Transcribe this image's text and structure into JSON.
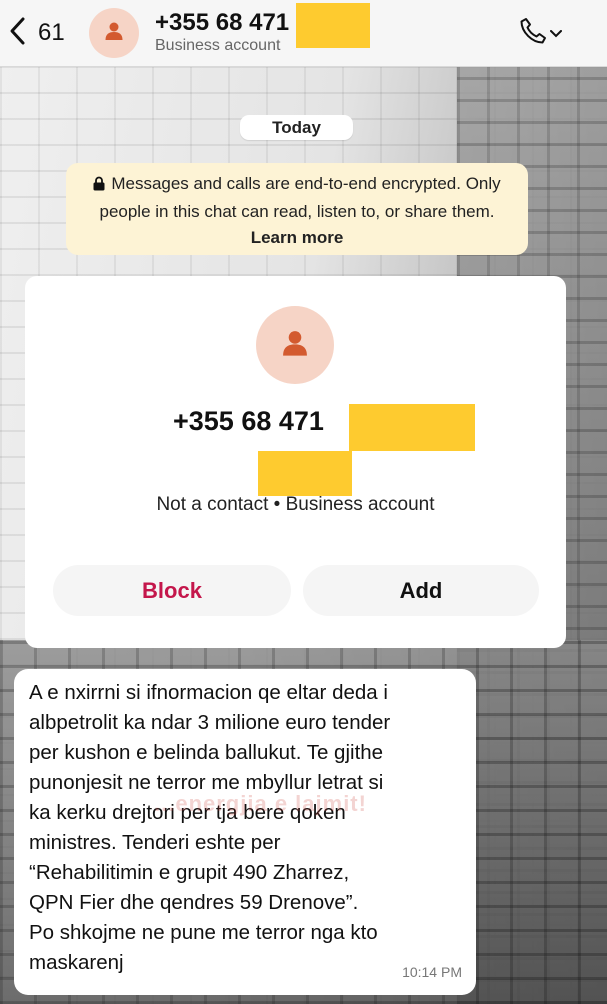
{
  "header": {
    "back_count": "61",
    "phone_number": "+355 68 471",
    "subtitle": "Business account"
  },
  "date_pill": "Today",
  "encryption_notice": {
    "text": "Messages and calls are end-to-end encrypted. Only people in this chat can read, listen to, or share them.",
    "link": "Learn more"
  },
  "contact_card": {
    "phone_number": "+355 68 471",
    "info": "Not a contact • Business account",
    "block_label": "Block",
    "add_label": "Add"
  },
  "message": {
    "text": "A e nxirrni si ifnormacion qe eltar deda i\nalbpetrolit ka ndar 3 milione euro tender\nper kushon e belinda ballukut. Te gjithe\npunonjesit ne terror me mbyllur letrat si\nka kerku drejtori per tja bere qoken\nministres. Tenderi eshte per\n“Rehabilitimin e grupit 490 Zharrez,\nQPN Fier dhe qendres 59 Drenove”.\nPo shkojme ne pune me terror nga kto\nmaskarenj",
    "time": "10:14 PM",
    "watermark": "...energjia e lajmit!"
  },
  "colors": {
    "redaction": "#fecb2f",
    "block": "#c4164b",
    "avatar_bg": "#f6d4c6",
    "avatar_fg": "#d35a2f",
    "notice_bg": "#fdf3d5"
  },
  "icons": [
    "chevron-left-icon",
    "person-icon",
    "phone-icon",
    "chevron-down-icon",
    "lock-icon"
  ]
}
